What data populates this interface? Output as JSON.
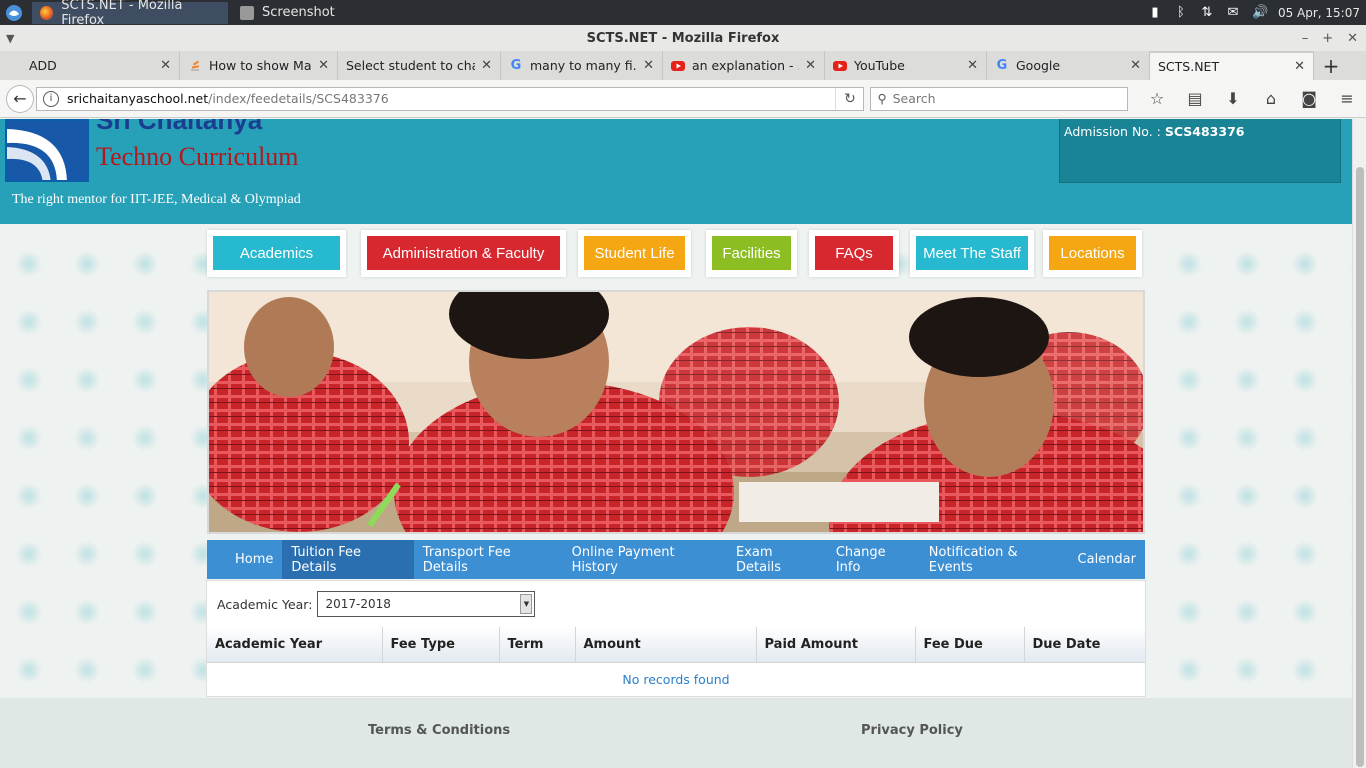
{
  "taskbar": {
    "tasks": [
      {
        "label": "SCTS.NET - Mozilla Firefox",
        "active": true
      },
      {
        "label": "Screenshot",
        "active": false
      }
    ],
    "datetime": "05 Apr, 15:07"
  },
  "window": {
    "title": "SCTS.NET - Mozilla Firefox"
  },
  "tabs": [
    {
      "label": "ADD",
      "icon": "none"
    },
    {
      "label": "How to show Ma...",
      "icon": "stackoverflow-icon"
    },
    {
      "label": "Select student to cha...",
      "icon": "none"
    },
    {
      "label": "many to many fi...",
      "icon": "google-icon"
    },
    {
      "label": "an explanation - ...",
      "icon": "youtube-icon"
    },
    {
      "label": "YouTube",
      "icon": "youtube-icon"
    },
    {
      "label": "Google",
      "icon": "google-icon"
    },
    {
      "label": "SCTS.NET",
      "icon": "none",
      "active": true
    }
  ],
  "navbar": {
    "url_host": "srichaitanyaschool.net",
    "url_path": "/index/feedetails/SCS483376",
    "search_placeholder": "Search"
  },
  "header": {
    "brand_top": "Sri Chaitanya",
    "brand": "Techno Curriculum",
    "tagline": "The right mentor for IIT-JEE, Medical & Olympiad",
    "admission_label": "Admission No. : ",
    "admission_number": "SCS483376"
  },
  "menu": [
    {
      "label": "Academics",
      "color": "#27b9cf"
    },
    {
      "label": "Administration & Faculty",
      "color": "#d7282f"
    },
    {
      "label": "Student Life",
      "color": "#f4a713"
    },
    {
      "label": "Facilities",
      "color": "#8cbd22"
    },
    {
      "label": "FAQs",
      "color": "#d7282f"
    },
    {
      "label": "Meet The Staff",
      "color": "#27b9cf"
    },
    {
      "label": "Locations",
      "color": "#f4a713"
    }
  ],
  "subnav": [
    {
      "label": "Home"
    },
    {
      "label": "Tuition Fee Details",
      "active": true
    },
    {
      "label": "Transport Fee Details"
    },
    {
      "label": "Online Payment History"
    },
    {
      "label": "Exam Details"
    },
    {
      "label": "Change Info"
    },
    {
      "label": "Notification & Events"
    },
    {
      "label": "Calendar"
    }
  ],
  "fees": {
    "academic_year_label": "Academic Year:",
    "academic_year_value": "2017-2018",
    "columns": [
      "Academic Year",
      "Fee Type",
      "Term",
      "Amount",
      "Paid Amount",
      "Fee Due",
      "Due Date"
    ],
    "empty_message": "No records found"
  },
  "footer": {
    "terms": "Terms & Conditions",
    "privacy": "Privacy Policy"
  }
}
